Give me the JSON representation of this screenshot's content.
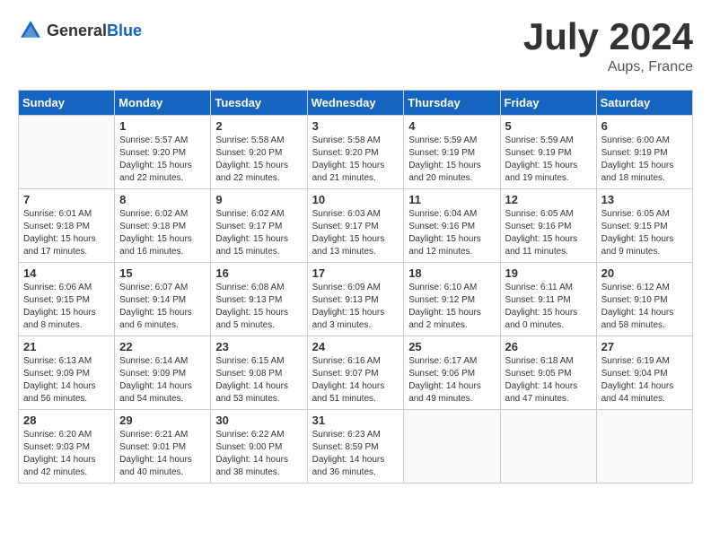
{
  "header": {
    "logo_general": "General",
    "logo_blue": "Blue",
    "month_title": "July 2024",
    "location": "Aups, France"
  },
  "days_of_week": [
    "Sunday",
    "Monday",
    "Tuesday",
    "Wednesday",
    "Thursday",
    "Friday",
    "Saturday"
  ],
  "weeks": [
    [
      {
        "day": "",
        "info": ""
      },
      {
        "day": "1",
        "info": "Sunrise: 5:57 AM\nSunset: 9:20 PM\nDaylight: 15 hours\nand 22 minutes."
      },
      {
        "day": "2",
        "info": "Sunrise: 5:58 AM\nSunset: 9:20 PM\nDaylight: 15 hours\nand 22 minutes."
      },
      {
        "day": "3",
        "info": "Sunrise: 5:58 AM\nSunset: 9:20 PM\nDaylight: 15 hours\nand 21 minutes."
      },
      {
        "day": "4",
        "info": "Sunrise: 5:59 AM\nSunset: 9:19 PM\nDaylight: 15 hours\nand 20 minutes."
      },
      {
        "day": "5",
        "info": "Sunrise: 5:59 AM\nSunset: 9:19 PM\nDaylight: 15 hours\nand 19 minutes."
      },
      {
        "day": "6",
        "info": "Sunrise: 6:00 AM\nSunset: 9:19 PM\nDaylight: 15 hours\nand 18 minutes."
      }
    ],
    [
      {
        "day": "7",
        "info": "Sunrise: 6:01 AM\nSunset: 9:18 PM\nDaylight: 15 hours\nand 17 minutes."
      },
      {
        "day": "8",
        "info": "Sunrise: 6:02 AM\nSunset: 9:18 PM\nDaylight: 15 hours\nand 16 minutes."
      },
      {
        "day": "9",
        "info": "Sunrise: 6:02 AM\nSunset: 9:17 PM\nDaylight: 15 hours\nand 15 minutes."
      },
      {
        "day": "10",
        "info": "Sunrise: 6:03 AM\nSunset: 9:17 PM\nDaylight: 15 hours\nand 13 minutes."
      },
      {
        "day": "11",
        "info": "Sunrise: 6:04 AM\nSunset: 9:16 PM\nDaylight: 15 hours\nand 12 minutes."
      },
      {
        "day": "12",
        "info": "Sunrise: 6:05 AM\nSunset: 9:16 PM\nDaylight: 15 hours\nand 11 minutes."
      },
      {
        "day": "13",
        "info": "Sunrise: 6:05 AM\nSunset: 9:15 PM\nDaylight: 15 hours\nand 9 minutes."
      }
    ],
    [
      {
        "day": "14",
        "info": "Sunrise: 6:06 AM\nSunset: 9:15 PM\nDaylight: 15 hours\nand 8 minutes."
      },
      {
        "day": "15",
        "info": "Sunrise: 6:07 AM\nSunset: 9:14 PM\nDaylight: 15 hours\nand 6 minutes."
      },
      {
        "day": "16",
        "info": "Sunrise: 6:08 AM\nSunset: 9:13 PM\nDaylight: 15 hours\nand 5 minutes."
      },
      {
        "day": "17",
        "info": "Sunrise: 6:09 AM\nSunset: 9:13 PM\nDaylight: 15 hours\nand 3 minutes."
      },
      {
        "day": "18",
        "info": "Sunrise: 6:10 AM\nSunset: 9:12 PM\nDaylight: 15 hours\nand 2 minutes."
      },
      {
        "day": "19",
        "info": "Sunrise: 6:11 AM\nSunset: 9:11 PM\nDaylight: 15 hours\nand 0 minutes."
      },
      {
        "day": "20",
        "info": "Sunrise: 6:12 AM\nSunset: 9:10 PM\nDaylight: 14 hours\nand 58 minutes."
      }
    ],
    [
      {
        "day": "21",
        "info": "Sunrise: 6:13 AM\nSunset: 9:09 PM\nDaylight: 14 hours\nand 56 minutes."
      },
      {
        "day": "22",
        "info": "Sunrise: 6:14 AM\nSunset: 9:09 PM\nDaylight: 14 hours\nand 54 minutes."
      },
      {
        "day": "23",
        "info": "Sunrise: 6:15 AM\nSunset: 9:08 PM\nDaylight: 14 hours\nand 53 minutes."
      },
      {
        "day": "24",
        "info": "Sunrise: 6:16 AM\nSunset: 9:07 PM\nDaylight: 14 hours\nand 51 minutes."
      },
      {
        "day": "25",
        "info": "Sunrise: 6:17 AM\nSunset: 9:06 PM\nDaylight: 14 hours\nand 49 minutes."
      },
      {
        "day": "26",
        "info": "Sunrise: 6:18 AM\nSunset: 9:05 PM\nDaylight: 14 hours\nand 47 minutes."
      },
      {
        "day": "27",
        "info": "Sunrise: 6:19 AM\nSunset: 9:04 PM\nDaylight: 14 hours\nand 44 minutes."
      }
    ],
    [
      {
        "day": "28",
        "info": "Sunrise: 6:20 AM\nSunset: 9:03 PM\nDaylight: 14 hours\nand 42 minutes."
      },
      {
        "day": "29",
        "info": "Sunrise: 6:21 AM\nSunset: 9:01 PM\nDaylight: 14 hours\nand 40 minutes."
      },
      {
        "day": "30",
        "info": "Sunrise: 6:22 AM\nSunset: 9:00 PM\nDaylight: 14 hours\nand 38 minutes."
      },
      {
        "day": "31",
        "info": "Sunrise: 6:23 AM\nSunset: 8:59 PM\nDaylight: 14 hours\nand 36 minutes."
      },
      {
        "day": "",
        "info": ""
      },
      {
        "day": "",
        "info": ""
      },
      {
        "day": "",
        "info": ""
      }
    ]
  ]
}
